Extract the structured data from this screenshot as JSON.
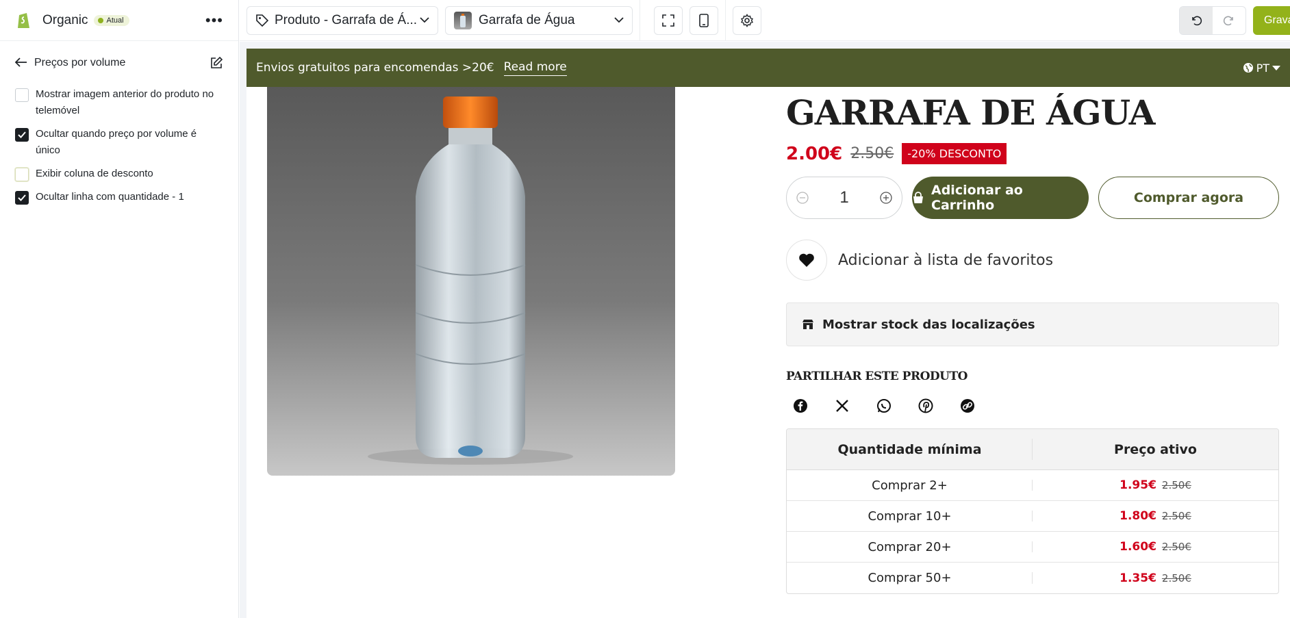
{
  "sidebar": {
    "store_name": "Organic",
    "status_badge": "Atual",
    "section_title": "Preços por volume",
    "options": [
      {
        "label": "Mostrar imagem anterior do produto no telemóvel",
        "checked": false
      },
      {
        "label": "Ocultar quando preço por volume é único",
        "checked": true
      },
      {
        "label": "Exibir coluna de desconto",
        "checked": false
      },
      {
        "label": "Ocultar linha com quantidade - 1",
        "checked": true
      }
    ]
  },
  "toolbar": {
    "template_select": "Produto - Garrafa de Á...",
    "product_select": "Garrafa de Água",
    "save_label": "Gravar"
  },
  "announcement": {
    "text": "Envios gratuitos para encomendas >20€",
    "link": "Read more",
    "language": "PT"
  },
  "product": {
    "title": "GARRAFA DE ÁGUA",
    "price": "2.00€",
    "compare_price": "2.50€",
    "discount_badge": "-20% DESCONTO",
    "quantity": "1",
    "add_to_cart": "Adicionar ao Carrinho",
    "buy_now": "Comprar agora",
    "wishlist": "Adicionar à lista de favoritos",
    "stock_locations": "Mostrar stock das localizações",
    "share_title": "PARTILHAR ESTE PRODUTO",
    "share_icons": [
      "facebook-icon",
      "x-icon",
      "whatsapp-icon",
      "pinterest-icon",
      "link-icon"
    ]
  },
  "volume_table": {
    "headers": [
      "Quantidade mínima",
      "Preço ativo"
    ],
    "rows": [
      {
        "qty": "Comprar 2+",
        "price": "1.95€",
        "old": "2.50€"
      },
      {
        "qty": "Comprar 10+",
        "price": "1.80€",
        "old": "2.50€"
      },
      {
        "qty": "Comprar 20+",
        "price": "1.60€",
        "old": "2.50€"
      },
      {
        "qty": "Comprar 50+",
        "price": "1.35€",
        "old": "2.50€"
      }
    ]
  },
  "colors": {
    "brand_green": "#4f5a2c",
    "accent_lime": "#93b21a",
    "sale_red": "#d0021b"
  }
}
